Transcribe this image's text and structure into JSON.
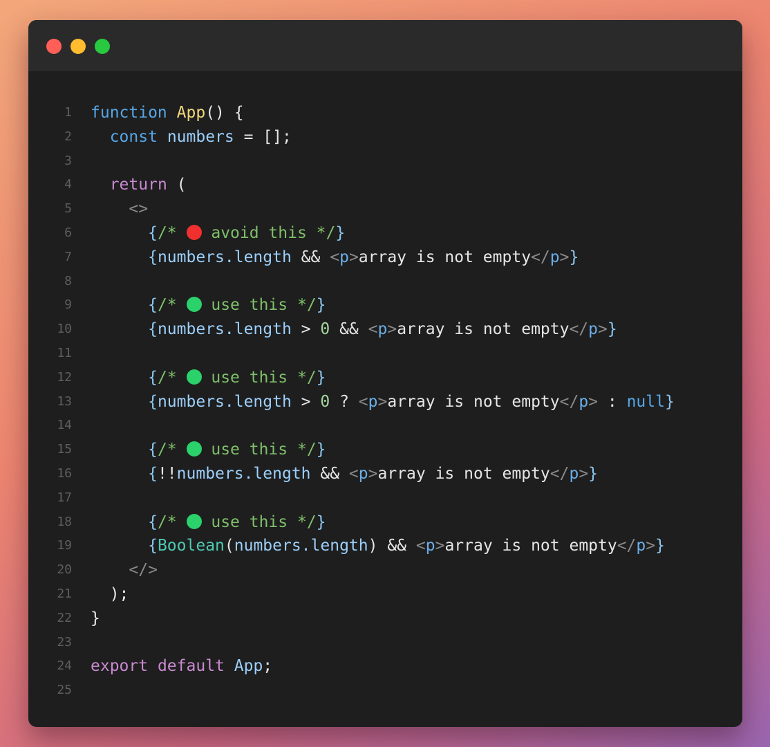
{
  "window": {
    "controls": [
      {
        "name": "close",
        "color": "#ff5f57"
      },
      {
        "name": "minimize",
        "color": "#febc2e"
      },
      {
        "name": "maximize",
        "color": "#28c840"
      }
    ]
  },
  "code": {
    "lines": [
      {
        "n": "1",
        "tokens": [
          [
            "kw-blue",
            "function"
          ],
          [
            "punc",
            " "
          ],
          [
            "fn-yellow",
            "App"
          ],
          [
            "punc",
            "() {"
          ]
        ]
      },
      {
        "n": "2",
        "tokens": [
          [
            "punc",
            "  "
          ],
          [
            "kw-blue",
            "const"
          ],
          [
            "punc",
            " "
          ],
          [
            "var",
            "numbers"
          ],
          [
            "punc",
            " = [];"
          ]
        ]
      },
      {
        "n": "3",
        "tokens": []
      },
      {
        "n": "4",
        "tokens": [
          [
            "punc",
            "  "
          ],
          [
            "kw-pink",
            "return"
          ],
          [
            "punc",
            " ("
          ]
        ]
      },
      {
        "n": "5",
        "tokens": [
          [
            "punc",
            "    "
          ],
          [
            "gray",
            "<>"
          ]
        ]
      },
      {
        "n": "6",
        "tokens": [
          [
            "punc",
            "      "
          ],
          [
            "cbrace",
            "{"
          ],
          [
            "comment",
            "/* "
          ],
          [
            "dot-red",
            ""
          ],
          [
            "comment",
            " avoid this */"
          ],
          [
            "cbrace",
            "}"
          ]
        ]
      },
      {
        "n": "7",
        "tokens": [
          [
            "punc",
            "      "
          ],
          [
            "cbrace",
            "{"
          ],
          [
            "var",
            "numbers.length"
          ],
          [
            "punc",
            " && "
          ],
          [
            "gray",
            "<"
          ],
          [
            "tag",
            "p"
          ],
          [
            "gray",
            ">"
          ],
          [
            "punc",
            "array is not empty"
          ],
          [
            "gray",
            "</"
          ],
          [
            "tag",
            "p"
          ],
          [
            "gray",
            ">"
          ],
          [
            "cbrace",
            "}"
          ]
        ]
      },
      {
        "n": "8",
        "tokens": []
      },
      {
        "n": "9",
        "tokens": [
          [
            "punc",
            "      "
          ],
          [
            "cbrace",
            "{"
          ],
          [
            "comment",
            "/* "
          ],
          [
            "dot-green",
            ""
          ],
          [
            "comment",
            " use this */"
          ],
          [
            "cbrace",
            "}"
          ]
        ]
      },
      {
        "n": "10",
        "tokens": [
          [
            "punc",
            "      "
          ],
          [
            "cbrace",
            "{"
          ],
          [
            "var",
            "numbers.length"
          ],
          [
            "punc",
            " > "
          ],
          [
            "num",
            "0"
          ],
          [
            "punc",
            " && "
          ],
          [
            "gray",
            "<"
          ],
          [
            "tag",
            "p"
          ],
          [
            "gray",
            ">"
          ],
          [
            "punc",
            "array is not empty"
          ],
          [
            "gray",
            "</"
          ],
          [
            "tag",
            "p"
          ],
          [
            "gray",
            ">"
          ],
          [
            "cbrace",
            "}"
          ]
        ]
      },
      {
        "n": "11",
        "tokens": []
      },
      {
        "n": "12",
        "tokens": [
          [
            "punc",
            "      "
          ],
          [
            "cbrace",
            "{"
          ],
          [
            "comment",
            "/* "
          ],
          [
            "dot-green",
            ""
          ],
          [
            "comment",
            " use this */"
          ],
          [
            "cbrace",
            "}"
          ]
        ]
      },
      {
        "n": "13",
        "tokens": [
          [
            "punc",
            "      "
          ],
          [
            "cbrace",
            "{"
          ],
          [
            "var",
            "numbers.length"
          ],
          [
            "punc",
            " > "
          ],
          [
            "num",
            "0"
          ],
          [
            "punc",
            " ? "
          ],
          [
            "gray",
            "<"
          ],
          [
            "tag",
            "p"
          ],
          [
            "gray",
            ">"
          ],
          [
            "punc",
            "array is not empty"
          ],
          [
            "gray",
            "</"
          ],
          [
            "tag",
            "p"
          ],
          [
            "gray",
            ">"
          ],
          [
            "punc",
            " : "
          ],
          [
            "null",
            "null"
          ],
          [
            "cbrace",
            "}"
          ]
        ]
      },
      {
        "n": "14",
        "tokens": []
      },
      {
        "n": "15",
        "tokens": [
          [
            "punc",
            "      "
          ],
          [
            "cbrace",
            "{"
          ],
          [
            "comment",
            "/* "
          ],
          [
            "dot-green",
            ""
          ],
          [
            "comment",
            " use this */"
          ],
          [
            "cbrace",
            "}"
          ]
        ]
      },
      {
        "n": "16",
        "tokens": [
          [
            "punc",
            "      "
          ],
          [
            "cbrace",
            "{"
          ],
          [
            "punc",
            "!!"
          ],
          [
            "var",
            "numbers.length"
          ],
          [
            "punc",
            " && "
          ],
          [
            "gray",
            "<"
          ],
          [
            "tag",
            "p"
          ],
          [
            "gray",
            ">"
          ],
          [
            "punc",
            "array is not empty"
          ],
          [
            "gray",
            "</"
          ],
          [
            "tag",
            "p"
          ],
          [
            "gray",
            ">"
          ],
          [
            "cbrace",
            "}"
          ]
        ]
      },
      {
        "n": "17",
        "tokens": []
      },
      {
        "n": "18",
        "tokens": [
          [
            "punc",
            "      "
          ],
          [
            "cbrace",
            "{"
          ],
          [
            "comment",
            "/* "
          ],
          [
            "dot-green",
            ""
          ],
          [
            "comment",
            " use this */"
          ],
          [
            "cbrace",
            "}"
          ]
        ]
      },
      {
        "n": "19",
        "tokens": [
          [
            "punc",
            "      "
          ],
          [
            "cbrace",
            "{"
          ],
          [
            "bool",
            "Boolean"
          ],
          [
            "punc",
            "("
          ],
          [
            "var",
            "numbers.length"
          ],
          [
            "punc",
            ") && "
          ],
          [
            "gray",
            "<"
          ],
          [
            "tag",
            "p"
          ],
          [
            "gray",
            ">"
          ],
          [
            "punc",
            "array is not empty"
          ],
          [
            "gray",
            "</"
          ],
          [
            "tag",
            "p"
          ],
          [
            "gray",
            ">"
          ],
          [
            "cbrace",
            "}"
          ]
        ]
      },
      {
        "n": "20",
        "tokens": [
          [
            "punc",
            "    "
          ],
          [
            "gray",
            "</>"
          ]
        ]
      },
      {
        "n": "21",
        "tokens": [
          [
            "punc",
            "  );"
          ]
        ]
      },
      {
        "n": "22",
        "tokens": [
          [
            "punc",
            "}"
          ]
        ]
      },
      {
        "n": "23",
        "tokens": []
      },
      {
        "n": "24",
        "tokens": [
          [
            "kw-pink",
            "export"
          ],
          [
            "punc",
            " "
          ],
          [
            "kw-pink",
            "default"
          ],
          [
            "punc",
            " "
          ],
          [
            "var",
            "App"
          ],
          [
            "punc",
            ";"
          ]
        ]
      },
      {
        "n": "25",
        "tokens": []
      }
    ]
  },
  "colors": {
    "dot_red": "#f0302e",
    "dot_green": "#2bd16a"
  }
}
